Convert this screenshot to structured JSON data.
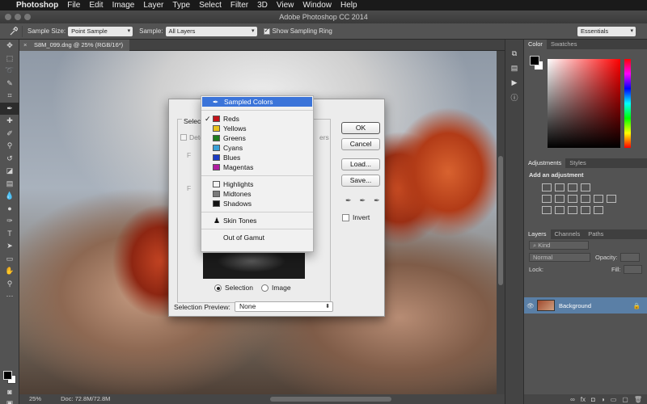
{
  "menubar": {
    "apple": "",
    "app_name": "Photoshop",
    "items": [
      "File",
      "Edit",
      "Image",
      "Layer",
      "Type",
      "Select",
      "Filter",
      "3D",
      "View",
      "Window",
      "Help"
    ]
  },
  "window": {
    "title": "Adobe Photoshop CC 2014"
  },
  "options_bar": {
    "sample_size_label": "Sample Size:",
    "sample_size_value": "Point Sample",
    "sample_label": "Sample:",
    "sample_value": "All Layers",
    "show_ring_label": "Show Sampling Ring",
    "show_ring_checked": true,
    "workspace_value": "Essentials"
  },
  "document": {
    "tab_label": "S8M_099.dng @ 25% (RGB/16*)",
    "close_glyph": "×"
  },
  "status_bar": {
    "zoom": "25%",
    "doc_info": "Doc: 72.8M/72.8M"
  },
  "panels": {
    "color_tabs": [
      "Color",
      "Swatches"
    ],
    "adjustment_tabs": [
      "Adjustments",
      "Styles"
    ],
    "adjustment_title": "Add an adjustment",
    "layers_tabs": [
      "Layers",
      "Channels",
      "Paths"
    ],
    "kind_label": "Kind",
    "blend_mode": "Normal",
    "opacity_label": "Opacity:",
    "lock_label": "Lock:",
    "fill_label": "Fill:",
    "layer_name": "Background"
  },
  "dialog": {
    "select_label": "Select",
    "detect_label": "Dete",
    "side_label_1": "F",
    "side_label_2": "F",
    "side_label_3": "ers",
    "ok_label": "OK",
    "cancel_label": "Cancel",
    "load_label": "Load...",
    "save_label": "Save...",
    "invert_label": "Invert",
    "radio_selection": "Selection",
    "radio_image": "Image",
    "selection_preview_label": "Selection Preview:",
    "selection_preview_value": "None"
  },
  "select_menu": {
    "selected": "Sampled Colors",
    "colors": [
      {
        "label": "Reds",
        "swatch": "#c4141c",
        "checked": true
      },
      {
        "label": "Yellows",
        "swatch": "#e8c21c"
      },
      {
        "label": "Greens",
        "swatch": "#1f7d1f"
      },
      {
        "label": "Cyans",
        "swatch": "#3aa0d8"
      },
      {
        "label": "Blues",
        "swatch": "#1c3cc4"
      },
      {
        "label": "Magentas",
        "swatch": "#b01ca0"
      }
    ],
    "tones": [
      {
        "label": "Highlights",
        "swatch": "#f4f4f4"
      },
      {
        "label": "Midtones",
        "swatch": "#7a7a7a"
      },
      {
        "label": "Shadows",
        "swatch": "#111111"
      }
    ],
    "skin_tones": "Skin Tones",
    "out_of_gamut": "Out of Gamut"
  },
  "icons": {
    "eyedropper": "eyedropper-icon",
    "lock": "lock-icon",
    "eye": "eye-icon"
  }
}
